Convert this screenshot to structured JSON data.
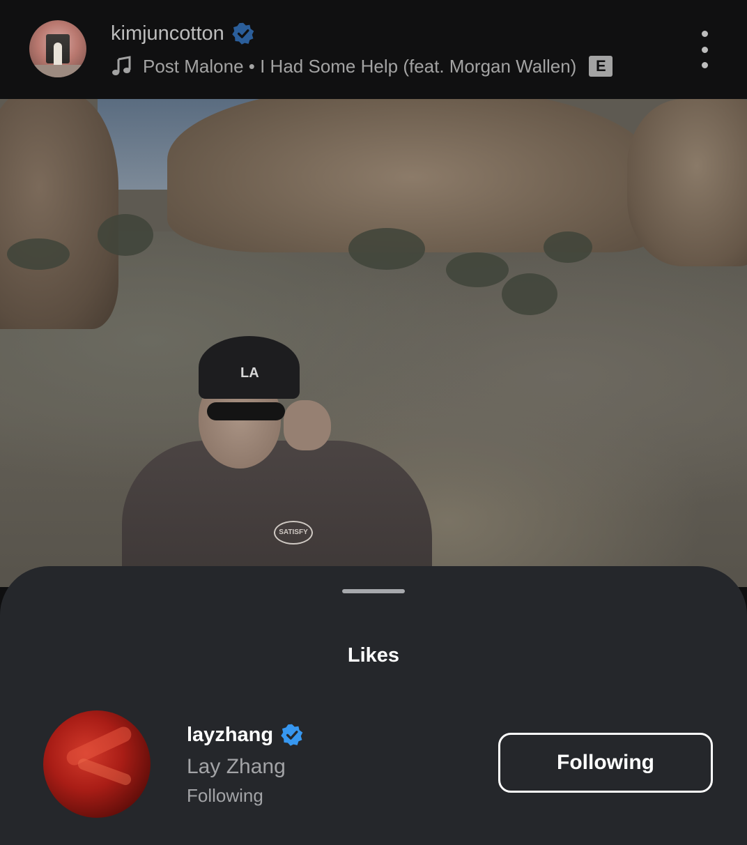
{
  "header": {
    "username": "kimjuncotton",
    "artist": "Post Malone",
    "separator": "•",
    "song": "I Had Some Help (feat. Morgan Wallen)",
    "explicit_label": "E",
    "icons": {
      "music": "music-note-icon",
      "verified": "verified-badge-icon",
      "more": "more-vertical-icon"
    }
  },
  "likes_sheet": {
    "title": "Likes",
    "users": [
      {
        "handle": "layzhang",
        "full_name": "Lay Zhang",
        "status": "Following",
        "button_label": "Following"
      }
    ]
  },
  "colors": {
    "verified": "#3797f0",
    "sheet_bg": "#25272b",
    "header_bg": "#101011"
  }
}
